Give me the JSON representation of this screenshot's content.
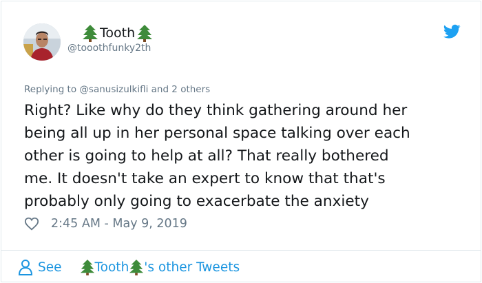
{
  "author": {
    "display_name": "Tooth",
    "handle": "@tooothfunky2th",
    "name_emoji": "evergreen-tree"
  },
  "reply_context": {
    "prefix": "Replying to ",
    "mention": "@sanusizulkifli",
    "suffix": " and 2 others"
  },
  "tweet": {
    "lines": [
      "Right? Like why do they think gathering around her",
      "being all up in her personal space talking over each",
      "other is going to help at all? That really bothered",
      "me. It doesn't take an expert to know that that's",
      "probably only going to exacerbate the anxiety"
    ],
    "timestamp": "2:45 AM - May 9, 2019"
  },
  "footer": {
    "see_label": "See",
    "others_suffix": "'s other Tweets"
  },
  "colors": {
    "accent": "#1b95e0",
    "twitter_blue": "#1da1f2",
    "secondary_text": "#657786",
    "border": "#e1e8ed"
  }
}
